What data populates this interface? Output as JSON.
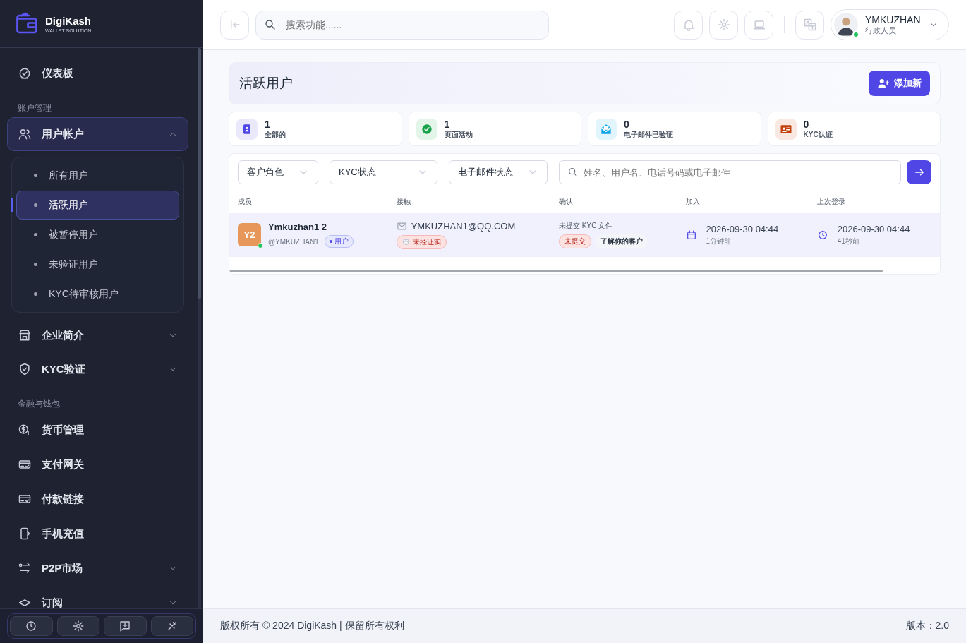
{
  "sidebar": {
    "logo": {
      "name": "DigiKash",
      "tagline": "WALLET SOLUTION"
    },
    "sections": [
      {
        "items": [
          {
            "label": "仪表板",
            "selected": false
          }
        ]
      },
      {
        "heading": "账户管理",
        "items": [
          {
            "label": "用户帐户",
            "selected": true,
            "expanded": true,
            "children": [
              {
                "label": "所有用户",
                "selected": false
              },
              {
                "label": "活跃用户",
                "selected": true
              },
              {
                "label": "被暂停用户",
                "selected": false
              },
              {
                "label": "未验证用户",
                "selected": false
              },
              {
                "label": "KYC待审核用户",
                "selected": false
              }
            ]
          },
          {
            "label": "企业简介",
            "selected": false,
            "expanded": false
          },
          {
            "label": "KYC验证",
            "selected": false,
            "expanded": false
          }
        ]
      },
      {
        "heading": "金融与钱包",
        "items": [
          {
            "label": "货币管理",
            "selected": false
          },
          {
            "label": "支付网关",
            "selected": false
          },
          {
            "label": "付款链接",
            "selected": false
          },
          {
            "label": "手机充值",
            "selected": false
          },
          {
            "label": "P2P市场",
            "selected": false,
            "expanded": false
          },
          {
            "label": "订阅",
            "selected": false,
            "expanded": false
          }
        ]
      }
    ]
  },
  "header": {
    "search": {
      "placeholder": "搜索功能......"
    },
    "user": {
      "name": "YMKUZHAN",
      "role": "行政人员",
      "online": true
    }
  },
  "page": {
    "title": "活跃用户",
    "add_button": "添加新"
  },
  "stats": [
    {
      "value": "1",
      "label": "全部的",
      "color": "#4f46e5"
    },
    {
      "value": "1",
      "label": "页面活动",
      "color": "#16a34a"
    },
    {
      "value": "0",
      "label": "电子邮件已验证",
      "color": "#0ea5e9"
    },
    {
      "value": "0",
      "label": "KYC认证",
      "color": "#c2410c"
    }
  ],
  "filters": {
    "selects": [
      "客户角色",
      "KYC状态",
      "电子邮件状态"
    ],
    "search": {
      "placeholder": "姓名、用户名、电话号码或电子邮件"
    }
  },
  "table": {
    "columns": [
      "成员",
      "接触",
      "确认",
      "加入",
      "上次登录"
    ],
    "rows": [
      {
        "initials": "Y2",
        "color": "#e8975a",
        "online": true,
        "name": "Ymkuzhan1 2",
        "username": "@YMKUZHAN1",
        "role": "用户",
        "email": "YMKUZHAN1@QQ.COM",
        "email_status": "未经证实",
        "email_verified": false,
        "kyc_text": "未提交 KYC 文件",
        "kyc_status": "未提交",
        "kyc_type": "了解你的客户",
        "joined": "2026-09-30 04:44",
        "joined_ago": "1分钟前",
        "last_login": "2026-09-30 04:44",
        "last_login_ago": "41秒前"
      }
    ]
  },
  "footer": {
    "copyright": "版权所有 © 2024 DigiKash | 保留所有权利",
    "version": "版本：2.0"
  }
}
